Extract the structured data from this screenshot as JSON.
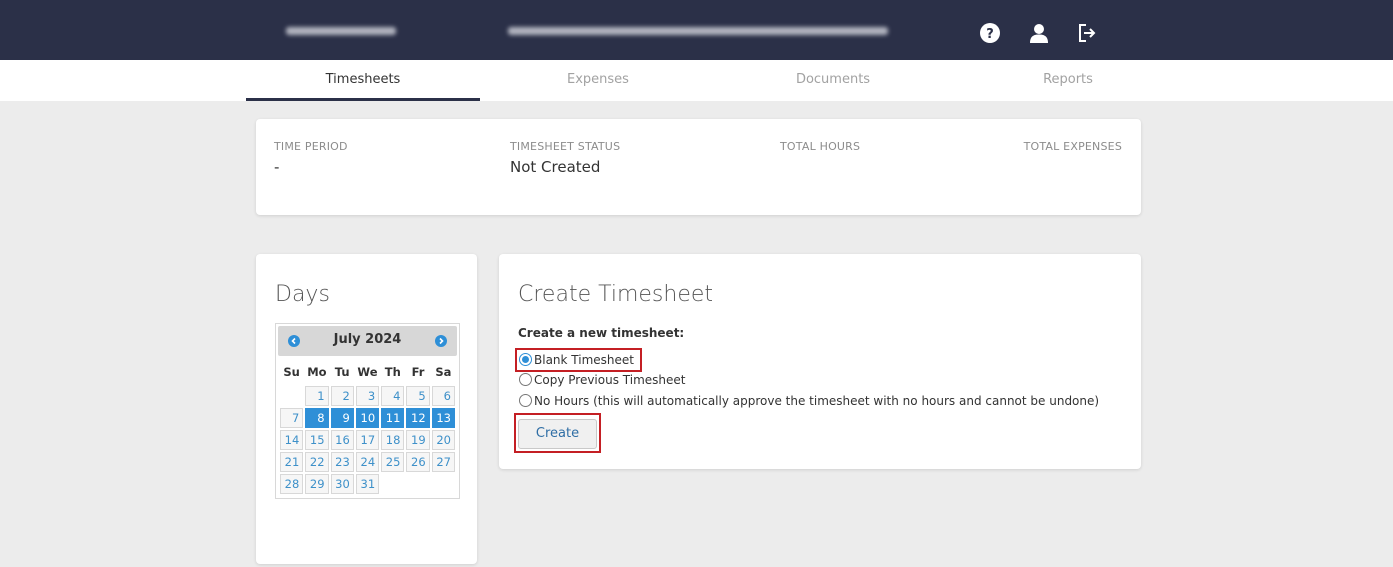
{
  "header": {
    "icons": [
      "question-circle-icon",
      "user-icon",
      "logout-icon"
    ]
  },
  "tabs": [
    {
      "label": "Timesheets",
      "active": true
    },
    {
      "label": "Expenses",
      "active": false
    },
    {
      "label": "Documents",
      "active": false
    },
    {
      "label": "Reports",
      "active": false
    }
  ],
  "summary": {
    "time_period_label": "TIME PERIOD",
    "time_period_value": "-",
    "status_label": "TIMESHEET STATUS",
    "status_value": "Not Created",
    "total_hours_label": "TOTAL HOURS",
    "total_expenses_label": "TOTAL EXPENSES"
  },
  "days": {
    "title": "Days",
    "calendar": {
      "month": "July 2024",
      "weekdays": [
        "Su",
        "Mo",
        "Tu",
        "We",
        "Th",
        "Fr",
        "Sa"
      ],
      "weeks": [
        [
          "",
          "1",
          "2",
          "3",
          "4",
          "5",
          "6"
        ],
        [
          "7",
          "8",
          "9",
          "10",
          "11",
          "12",
          "13"
        ],
        [
          "14",
          "15",
          "16",
          "17",
          "18",
          "19",
          "20"
        ],
        [
          "21",
          "22",
          "23",
          "24",
          "25",
          "26",
          "27"
        ],
        [
          "28",
          "29",
          "30",
          "31",
          "",
          "",
          ""
        ]
      ],
      "selected_days": [
        "8",
        "9",
        "10",
        "11",
        "12",
        "13"
      ]
    }
  },
  "create": {
    "title": "Create Timesheet",
    "subtitle": "Create a new timesheet:",
    "options": [
      {
        "label": "Blank Timesheet",
        "selected": true
      },
      {
        "label": "Copy Previous Timesheet",
        "selected": false
      },
      {
        "label": "No Hours (this will automatically approve the timesheet with no hours and cannot be undone)",
        "selected": false
      }
    ],
    "button_label": "Create"
  },
  "colors": {
    "topbar": "#2b3048",
    "accent": "#2e8fd7",
    "highlight": "#c41f24"
  }
}
